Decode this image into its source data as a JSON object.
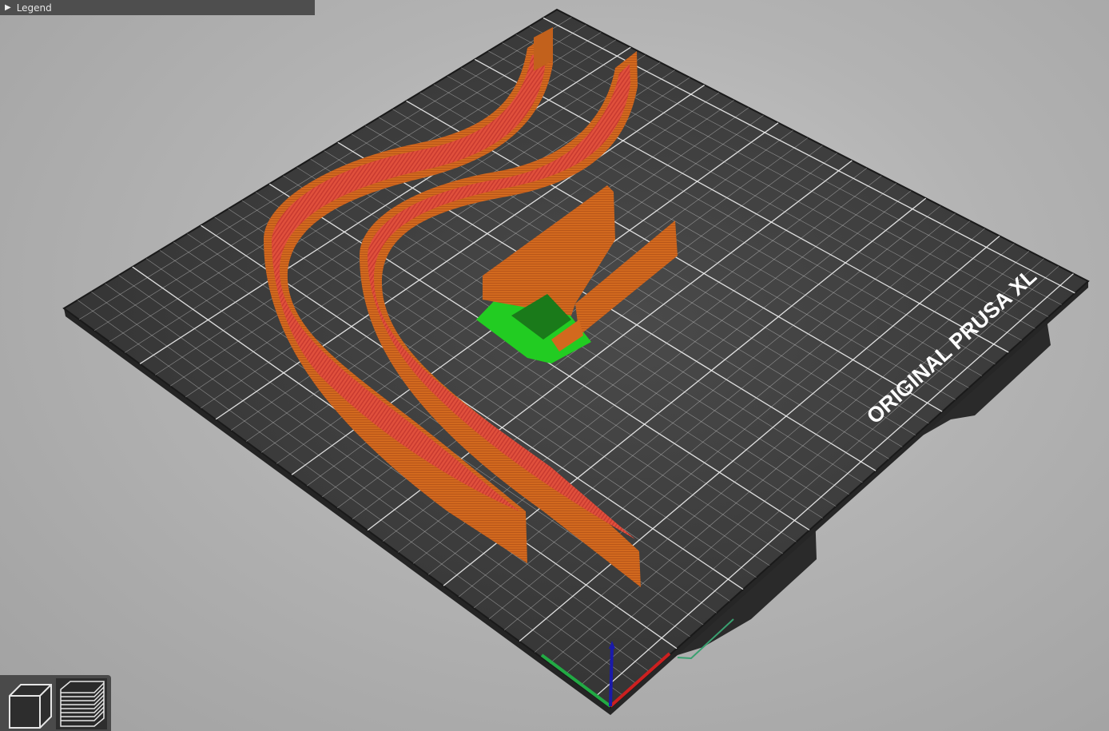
{
  "legend": {
    "label": "Legend",
    "expanded": false
  },
  "bed": {
    "brand_text": "ORIGINAL PRUSA XL"
  },
  "toolbar": {
    "items": [
      {
        "name": "3d-view",
        "icon": "cube-icon",
        "active": false
      },
      {
        "name": "preview",
        "icon": "layers-icon",
        "active": true
      }
    ]
  },
  "colors": {
    "background": "#b3b3b3",
    "bed_surface": "#3c3c3c",
    "grid": "#e8e8e8",
    "perimeter": "#d2691e",
    "infill": "#e04a3a",
    "support": "#22cc22",
    "axis_x": "#cc2020",
    "axis_y": "#20aa40",
    "axis_z": "#1a1aaa"
  }
}
